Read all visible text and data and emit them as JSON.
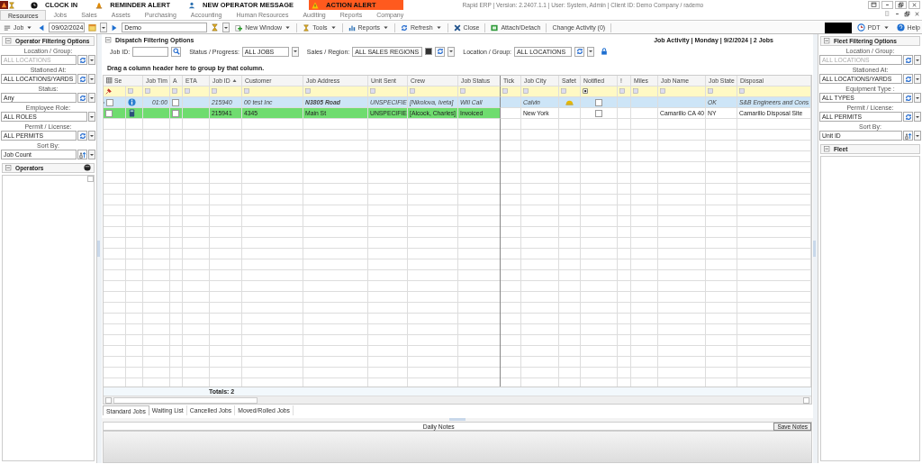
{
  "alert_bar": {
    "items": [
      {
        "label": "CLOCK IN",
        "highlight": false
      },
      {
        "label": "REMINDER ALERT",
        "highlight": false
      },
      {
        "label": "NEW OPERATOR MESSAGE",
        "highlight": false
      },
      {
        "label": "ACTION ALERT",
        "highlight": true
      }
    ],
    "title": "Rapid ERP | Version: 2.2407.1.1 | User: System, Admin | Client ID: Demo Company / rademo"
  },
  "menu_tabs": [
    {
      "label": "Resources",
      "selected": true
    },
    {
      "label": "Jobs",
      "selected": false
    },
    {
      "label": "Sales",
      "selected": false
    },
    {
      "label": "Assets",
      "selected": false
    },
    {
      "label": "Purchasing",
      "selected": false
    },
    {
      "label": "Accounting",
      "selected": false
    },
    {
      "label": "Human Resources",
      "selected": false
    },
    {
      "label": "Auditing",
      "selected": false
    },
    {
      "label": "Reports",
      "selected": false
    },
    {
      "label": "Company",
      "selected": false
    }
  ],
  "toolbar": {
    "module": "Job",
    "date": "09/02/2024",
    "search_value": "Demo",
    "buttons": [
      {
        "label": "New Window",
        "dropdown": true
      },
      {
        "label": "Tools",
        "dropdown": true
      },
      {
        "label": "Reports",
        "dropdown": true
      },
      {
        "label": "Refresh",
        "dropdown": true
      },
      {
        "label": "Close",
        "dropdown": false
      },
      {
        "label": "Attach/Detach",
        "dropdown": false
      },
      {
        "label": "Change Activity (0)",
        "dropdown": false
      }
    ],
    "timezone": "PDT",
    "help": "Help"
  },
  "operator_panel": {
    "title": "Operator Filtering Options",
    "fields": [
      {
        "label": "Location / Group:",
        "value": "ALL LOCATIONS",
        "disabled": true,
        "kind": "refresh"
      },
      {
        "label": "Stationed At:",
        "value": "ALL LOCATIONS/YARDS",
        "disabled": false,
        "kind": "refresh"
      },
      {
        "label": "Status:",
        "value": "Any",
        "disabled": false,
        "kind": "refresh"
      },
      {
        "label": "Employee Role:",
        "value": "ALL ROLES",
        "disabled": false,
        "kind": "plain"
      },
      {
        "label": "Permit / License:",
        "value": "ALL PERMITS",
        "disabled": false,
        "kind": "refresh"
      },
      {
        "label": "Sort By:",
        "value": "Job Count",
        "disabled": false,
        "kind": "sort"
      }
    ],
    "list_title": "Operators"
  },
  "dispatch": {
    "title": "Dispatch Filtering Options",
    "summary": "Job Activity | Monday | 9/2/2024 | 2 Jobs",
    "job_id": {
      "label": "Job ID:"
    },
    "status": {
      "label": "Status / Progress:",
      "value": "ALL JOBS"
    },
    "sales": {
      "label": "Sales / Region:",
      "value": "ALL SALES REGIONS",
      "checked": true
    },
    "location": {
      "label": "Location / Group:",
      "value": "ALL LOCATIONS",
      "locked": true
    },
    "group_hint": "Drag a column header here to group by that column."
  },
  "table": {
    "columns": [
      {
        "label": "Se",
        "kind": "check"
      },
      {
        "kind": "icon"
      },
      {
        "label": "Job Tim",
        "kind": "text"
      },
      {
        "label": "A",
        "kind": "check"
      },
      {
        "label": "ETA",
        "kind": "text"
      },
      {
        "label": "Job ID",
        "kind": "text",
        "sorted": true
      },
      {
        "label": "Customer",
        "kind": "text"
      },
      {
        "label": "Job Address",
        "kind": "text"
      },
      {
        "label": "Unit Sent",
        "kind": "text"
      },
      {
        "label": "Crew",
        "kind": "text"
      },
      {
        "label": "Job Status",
        "kind": "text"
      },
      {
        "label": "Tick",
        "kind": "text"
      },
      {
        "label": "Job City",
        "kind": "text"
      },
      {
        "label": "Safet",
        "kind": "icon"
      },
      {
        "label": "Notified",
        "kind": "check"
      },
      {
        "label": "!",
        "kind": "text"
      },
      {
        "label": "Miles",
        "kind": "text"
      },
      {
        "label": "Job Name",
        "kind": "text"
      },
      {
        "label": "Job State",
        "kind": "text"
      },
      {
        "label": "Disposal",
        "kind": "text"
      }
    ],
    "rows": [
      {
        "current": true,
        "italic": true,
        "cells": [
          {
            "checked": false
          },
          {
            "kind": "info"
          },
          "01:00",
          {
            "checked": false
          },
          null,
          "215940",
          "00 test Inc",
          {
            "text": "N3805 Road",
            "bold": true
          },
          "UNSPECIFIE",
          "[Nikolova, Iveta]",
          "Will Call",
          null,
          "Calvin",
          {
            "kind": "hardhat"
          },
          {
            "checked": false
          },
          null,
          null,
          null,
          "OK",
          "S&B Engineers and Cons"
        ]
      },
      {
        "current": false,
        "italic": false,
        "color": "#6fdc6f",
        "cells": [
          {
            "checked": false
          },
          {
            "kind": "calculator"
          },
          null,
          {
            "checked": false
          },
          null,
          "215941",
          "4345",
          "Main St",
          "UNSPECIFIE",
          "[Alcock, Charles]",
          "Invoiced",
          null,
          "New York",
          null,
          {
            "checked": false
          },
          null,
          null,
          "Camarillo CA 40",
          "NY",
          "Camarillo Disposal Site"
        ]
      }
    ],
    "totals": "Totals:  2"
  },
  "job_tabs": [
    {
      "label": "Standard Jobs",
      "selected": true
    },
    {
      "label": "Waiting List",
      "selected": false
    },
    {
      "label": "Cancelled Jobs",
      "selected": false
    },
    {
      "label": "Moved/Rolled Jobs",
      "selected": false
    }
  ],
  "notes": {
    "title": "Daily Notes",
    "save": "Save Notes"
  },
  "fleet_panel": {
    "title": "Fleet Filtering Options",
    "fields": [
      {
        "label": "Location / Group:",
        "value": "ALL LOCATIONS",
        "disabled": true,
        "kind": "refresh"
      },
      {
        "label": "Stationed At:",
        "value": "ALL LOCATIONS/YARDS",
        "disabled": false,
        "kind": "refresh"
      },
      {
        "label": "Equipment Type :",
        "value": "ALL TYPES",
        "disabled": false,
        "kind": "refresh"
      },
      {
        "label": "Permit / License:",
        "value": "ALL PERMITS",
        "disabled": false,
        "kind": "refresh"
      },
      {
        "label": "Sort By:",
        "value": "Unit ID",
        "disabled": false,
        "kind": "sort"
      }
    ],
    "list_title": "Fleet"
  }
}
